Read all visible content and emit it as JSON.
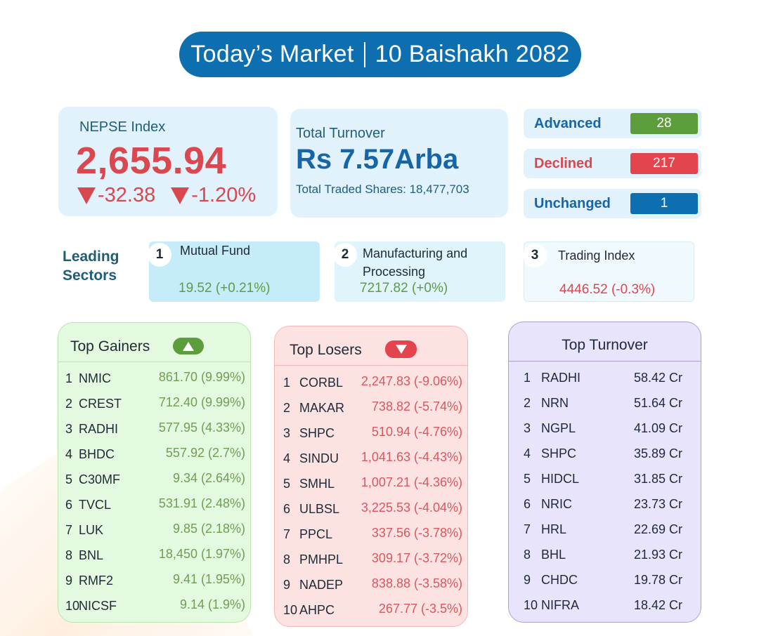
{
  "header": {
    "title": "Today’s Market",
    "date": "10 Baishakh 2082",
    "color": "#0e6fb0"
  },
  "nepse": {
    "label": "NEPSE Index",
    "value": "2,655.94",
    "change_points": "-32.38",
    "change_percent": "-1.20%",
    "direction": "down"
  },
  "turnover": {
    "label": "Total Turnover",
    "value": "Rs 7.57Arba",
    "traded_shares": "Total Traded Shares: 18,477,703"
  },
  "breadth": {
    "advanced": {
      "label": "Advanced",
      "value": "28",
      "color": "#5d9e3c"
    },
    "declined": {
      "label": "Declined",
      "value": "217",
      "color": "#e3444d"
    },
    "unchanged": {
      "label": "Unchanged",
      "value": "1",
      "color": "#0e6fb0"
    }
  },
  "leading_sectors": {
    "title_line1": "Leading",
    "title_line2": "Sectors",
    "items": [
      {
        "rank": "1",
        "name": "Mutual Fund",
        "value": "19.52 (+0.21%)"
      },
      {
        "rank": "2",
        "name": "Manufacturing and Processing",
        "value": "7217.82 (+0%)"
      },
      {
        "rank": "3",
        "name": "Trading Index",
        "value": "4446.52 (-0.3%)"
      }
    ]
  },
  "top_gainers": {
    "title": "Top Gainers",
    "badge_icon": "triangle-up-icon",
    "rows": [
      {
        "idx": "1",
        "symbol": "NMIC",
        "value": "861.70 (9.99%)"
      },
      {
        "idx": "2",
        "symbol": "CREST",
        "value": "712.40 (9.99%)"
      },
      {
        "idx": "3",
        "symbol": "RADHI",
        "value": "577.95 (4.33%)"
      },
      {
        "idx": "4",
        "symbol": "BHDC",
        "value": "557.92 (2.7%)"
      },
      {
        "idx": "5",
        "symbol": "C30MF",
        "value": "9.34 (2.64%)"
      },
      {
        "idx": "6",
        "symbol": "TVCL",
        "value": "531.91 (2.48%)"
      },
      {
        "idx": "7",
        "symbol": "LUK",
        "value": "9.85 (2.18%)"
      },
      {
        "idx": "8",
        "symbol": "BNL",
        "value": "18,450 (1.97%)"
      },
      {
        "idx": "9",
        "symbol": "RMF2",
        "value": "9.41 (1.95%)"
      },
      {
        "idx": "10",
        "symbol": "NICSF",
        "value": "9.14 (1.9%)"
      }
    ]
  },
  "top_losers": {
    "title": "Top Losers",
    "badge_icon": "triangle-down-icon",
    "rows": [
      {
        "idx": "1",
        "symbol": "CORBL",
        "value": "2,247.83 (-9.06%)"
      },
      {
        "idx": "2",
        "symbol": "MAKAR",
        "value": "738.82 (-5.74%)"
      },
      {
        "idx": "3",
        "symbol": "SHPC",
        "value": "510.94 (-4.76%)"
      },
      {
        "idx": "4",
        "symbol": "SINDU",
        "value": "1,041.63 (-4.43%)"
      },
      {
        "idx": "5",
        "symbol": "SMHL",
        "value": "1,007.21 (-4.36%)"
      },
      {
        "idx": "6",
        "symbol": "ULBSL",
        "value": "3,225.53 (-4.04%)"
      },
      {
        "idx": "7",
        "symbol": "PPCL",
        "value": "337.56 (-3.78%)"
      },
      {
        "idx": "8",
        "symbol": "PMHPL",
        "value": "309.17 (-3.72%)"
      },
      {
        "idx": "9",
        "symbol": "NADEP",
        "value": "838.88 (-3.58%)"
      },
      {
        "idx": "10",
        "symbol": "AHPC",
        "value": "267.77 (-3.5%)"
      }
    ]
  },
  "top_turnover": {
    "title": "Top Turnover",
    "rows": [
      {
        "idx": "1",
        "symbol": "RADHI",
        "value": "58.42 Cr"
      },
      {
        "idx": "2",
        "symbol": "NRN",
        "value": "51.64 Cr"
      },
      {
        "idx": "3",
        "symbol": "NGPL",
        "value": "41.09 Cr"
      },
      {
        "idx": "4",
        "symbol": "SHPC",
        "value": "35.89 Cr"
      },
      {
        "idx": "5",
        "symbol": "HIDCL",
        "value": "31.85 Cr"
      },
      {
        "idx": "6",
        "symbol": "NRIC",
        "value": "23.73 Cr"
      },
      {
        "idx": "7",
        "symbol": "HRL",
        "value": "22.69 Cr"
      },
      {
        "idx": "8",
        "symbol": "BHL",
        "value": "21.93 Cr"
      },
      {
        "idx": "9",
        "symbol": "CHDC",
        "value": "19.78 Cr"
      },
      {
        "idx": "10",
        "symbol": "NIFRA",
        "value": "18.42 Cr"
      }
    ]
  }
}
